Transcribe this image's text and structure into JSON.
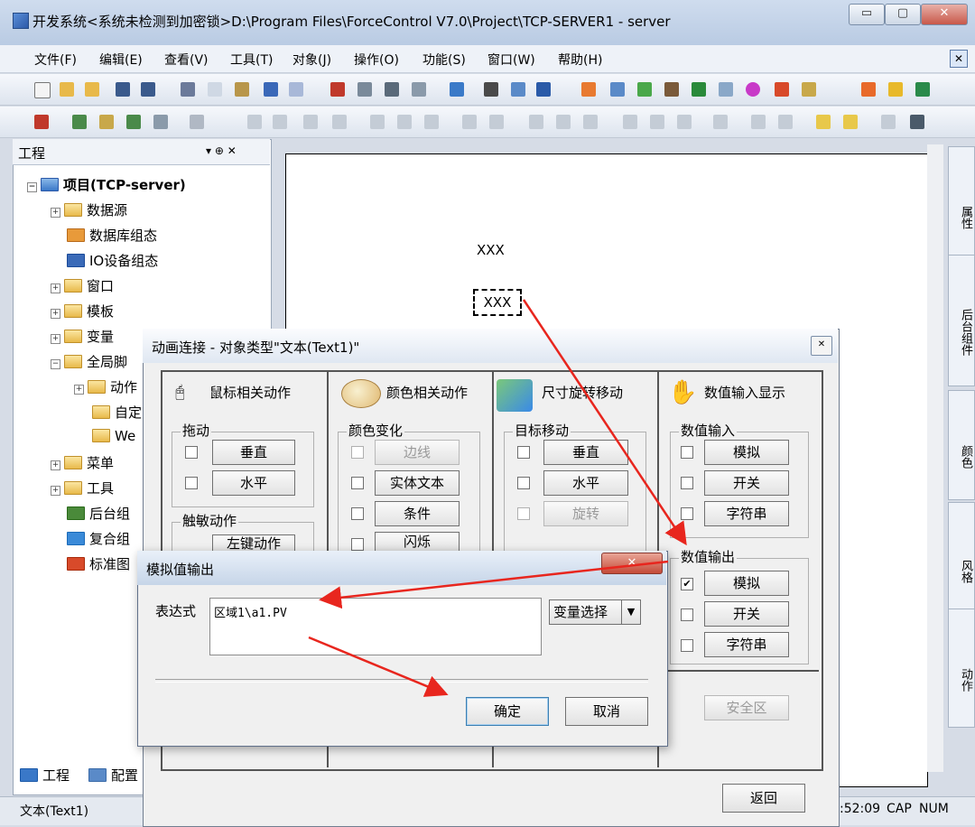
{
  "window": {
    "title": "开发系统<系统未检测到加密锁>D:\\Program Files\\ForceControl V7.0\\Project\\TCP-SERVER1 - server",
    "min_glyph": "▭",
    "max_glyph": "▢",
    "close_glyph": "✕"
  },
  "menu": {
    "items": [
      "文件(F)",
      "编辑(E)",
      "查看(V)",
      "工具(T)",
      "对象(J)",
      "操作(O)",
      "功能(S)",
      "窗口(W)",
      "帮助(H)"
    ],
    "close_glyph": "✕"
  },
  "left_panel": {
    "title": "工程",
    "pin": "▾ ⊕ ✕",
    "tree": [
      {
        "label": "项目(TCP-server)",
        "pm": "−"
      },
      {
        "label": "数据源",
        "pm": "+"
      },
      {
        "label": "数据库组态",
        "pm": ""
      },
      {
        "label": "IO设备组态",
        "pm": ""
      },
      {
        "label": "窗口",
        "pm": "+"
      },
      {
        "label": "模板",
        "pm": "+"
      },
      {
        "label": "变量",
        "pm": "+"
      },
      {
        "label": "全局脚",
        "pm": "−"
      },
      {
        "label": "动作",
        "pm": "+"
      },
      {
        "label": "自定",
        "pm": ""
      },
      {
        "label": "We",
        "pm": ""
      },
      {
        "label": "菜单",
        "pm": "+"
      },
      {
        "label": "工具",
        "pm": "+"
      },
      {
        "label": "后台组",
        "pm": ""
      },
      {
        "label": "复合组",
        "pm": ""
      },
      {
        "label": "标准图",
        "pm": ""
      }
    ],
    "bottom_tabs": [
      "工程",
      "配置"
    ]
  },
  "canvas": {
    "text1": "XXX",
    "text2": "XXX"
  },
  "right_tabs": [
    "属性",
    "后台组件",
    "颜色",
    "风格",
    "动作"
  ],
  "status": {
    "left": "文本(Text1)",
    "time": ":52:09",
    "cap": "CAP",
    "num": "NUM"
  },
  "dialog_animation": {
    "title": "动画连接 - 对象类型\"文本(Text1)\"",
    "close_glyph": "✕",
    "columns": {
      "mouse": {
        "head": "鼠标相关动作",
        "drag_group": "拖动",
        "drag_vertical": "垂直",
        "drag_horizontal": "水平",
        "touch_group": "触敏动作",
        "left_key": "左键动作"
      },
      "color": {
        "head": "颜色相关动作",
        "group": "颜色变化",
        "edge": "边线",
        "solid_text": "实体文本",
        "condition": "条件",
        "blink": "闪烁"
      },
      "size": {
        "head": "尺寸旋转移动",
        "group": "目标移动",
        "vertical": "垂直",
        "horizontal": "水平",
        "rotate": "旋转"
      },
      "value": {
        "head": "数值输入显示",
        "input_group": "数值输入",
        "in_analog": "模拟",
        "in_switch": "开关",
        "in_string": "字符串",
        "output_group": "数值输出",
        "out_analog": "模拟",
        "out_switch": "开关",
        "out_string": "字符串",
        "out_analog_checked": true
      }
    },
    "safe_zone": "安全区",
    "return": "返回"
  },
  "dialog_analog_output": {
    "title": "模拟值输出",
    "close_glyph": "✕",
    "expression_label": "表达式",
    "expression_value": "区域1\\a1.PV",
    "var_select": "变量选择",
    "ok": "确定",
    "cancel": "取消"
  }
}
